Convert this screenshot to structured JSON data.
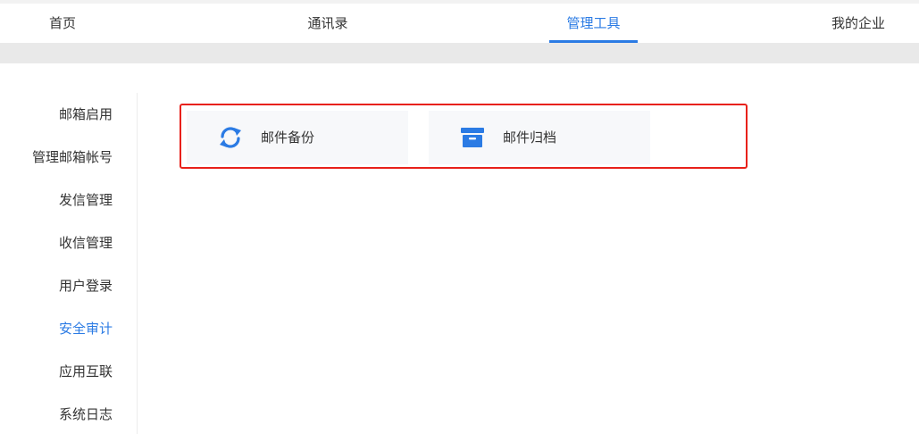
{
  "top_nav": {
    "tabs": [
      {
        "label": "首页"
      },
      {
        "label": "通讯录"
      },
      {
        "label": "管理工具"
      },
      {
        "label": "我的企业"
      }
    ],
    "active_tab": "管理工具"
  },
  "sidebar": {
    "items": [
      {
        "label": "邮箱启用"
      },
      {
        "label": "管理邮箱帐号"
      },
      {
        "label": "发信管理"
      },
      {
        "label": "收信管理"
      },
      {
        "label": "用户登录"
      },
      {
        "label": "安全审计"
      },
      {
        "label": "应用互联"
      },
      {
        "label": "系统日志"
      }
    ],
    "active_item": "安全审计"
  },
  "tools": [
    {
      "label": "邮件备份",
      "icon": "sync-icon"
    },
    {
      "label": "邮件归档",
      "icon": "archive-box-icon"
    }
  ],
  "colors": {
    "accent": "#2b7be4",
    "highlight_border": "#e8211a",
    "card_bg": "#f7f8fa",
    "band": "#e9e9e9"
  }
}
